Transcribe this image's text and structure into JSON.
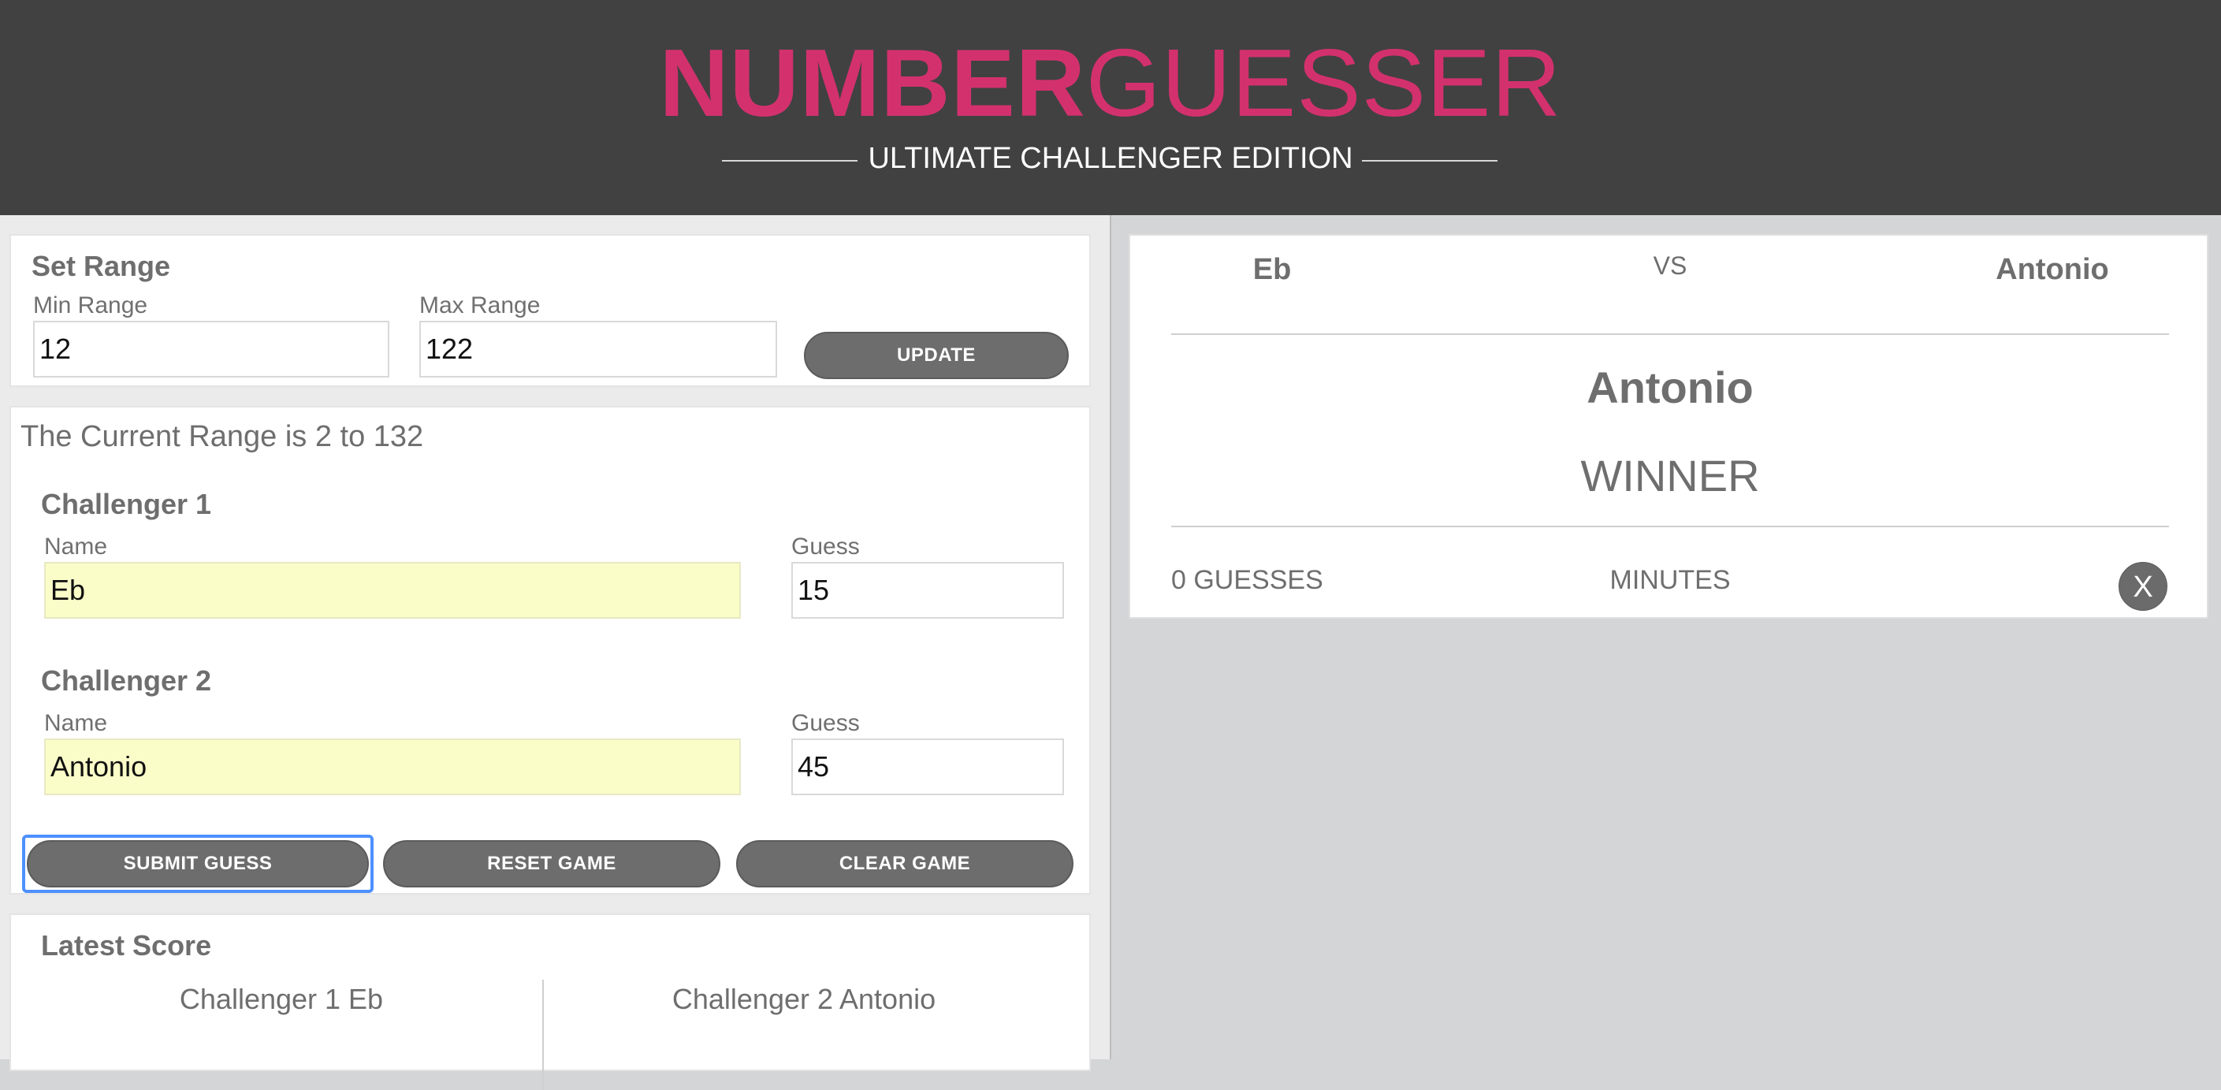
{
  "header": {
    "brand_bold": "NUMBER",
    "brand_light": "GUESSER",
    "edition": "ULTIMATE CHALLENGER EDITION"
  },
  "set_range": {
    "title": "Set Range",
    "min_label": "Min Range",
    "min_value": "12",
    "max_label": "Max Range",
    "max_value": "122",
    "update_label": "UPDATE"
  },
  "game": {
    "current_range_text": "The Current Range is 2 to 132",
    "challenger1": {
      "title": "Challenger 1",
      "name_label": "Name",
      "name_value": "Eb",
      "guess_label": "Guess",
      "guess_value": "15"
    },
    "challenger2": {
      "title": "Challenger 2",
      "name_label": "Name",
      "name_value": "Antonio",
      "guess_label": "Guess",
      "guess_value": "45"
    },
    "submit_label": "SUBMIT GUESS",
    "reset_label": "RESET GAME",
    "clear_label": "CLEAR GAME"
  },
  "latest_score": {
    "title": "Latest Score",
    "col1": "Challenger 1 Eb",
    "col2": "Challenger 2 Antonio"
  },
  "result_card": {
    "player1": "Eb",
    "vs": "VS",
    "player2": "Antonio",
    "winner_name": "Antonio",
    "winner_label": "WINNER",
    "guesses": "0 GUESSES",
    "minutes": "MINUTES",
    "close_label": "X"
  }
}
